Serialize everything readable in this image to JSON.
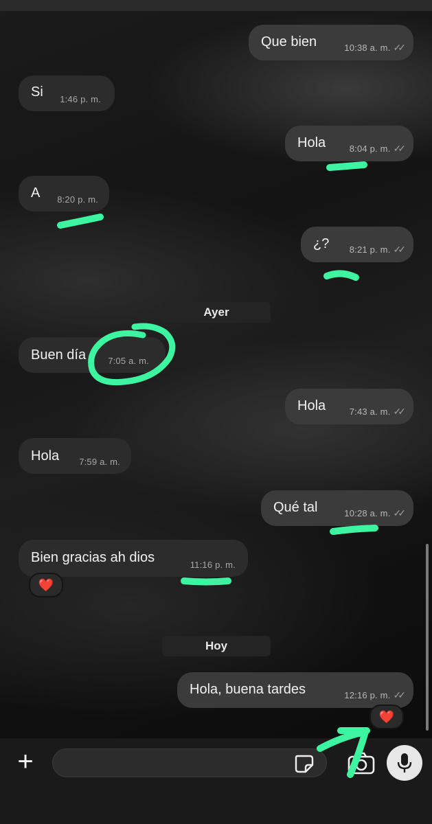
{
  "messages": [
    {
      "text": "Que bien",
      "time": "10:38 a. m.",
      "ticks": "✓✓"
    },
    {
      "text": "Si",
      "time": "1:46 p. m."
    },
    {
      "text": "Hola",
      "time": "8:04 p. m.",
      "ticks": "✓✓"
    },
    {
      "text": "A",
      "time": "8:20 p. m."
    },
    {
      "text": "¿?",
      "time": "8:21 p. m.",
      "ticks": "✓✓"
    },
    {
      "text": "Buen día",
      "time": "7:05 a. m."
    },
    {
      "text": "Hola",
      "time": "7:43 a. m.",
      "ticks": "✓✓"
    },
    {
      "text": "Hola",
      "time": "7:59 a. m."
    },
    {
      "text": "Qué tal",
      "time": "10:28 a. m.",
      "ticks": "✓✓"
    },
    {
      "text": "Bien gracias ah dios",
      "time": "11:16 p. m."
    },
    {
      "text": "Hola, buena tardes",
      "time": "12:16 p. m.",
      "ticks": "✓✓"
    }
  ],
  "day_separators": {
    "ayer": "Ayer",
    "hoy": "Hoy"
  },
  "reactions": {
    "heart": "❤️"
  },
  "icons": {
    "plus": "plus-icon",
    "sticker": "sticker-icon",
    "camera": "camera-icon",
    "mic": "microphone-icon"
  },
  "colors": {
    "annotation_green": "#3df5a0",
    "outgoing_bubble": "#3b3b3b",
    "incoming_bubble": "#2c2c2c"
  }
}
